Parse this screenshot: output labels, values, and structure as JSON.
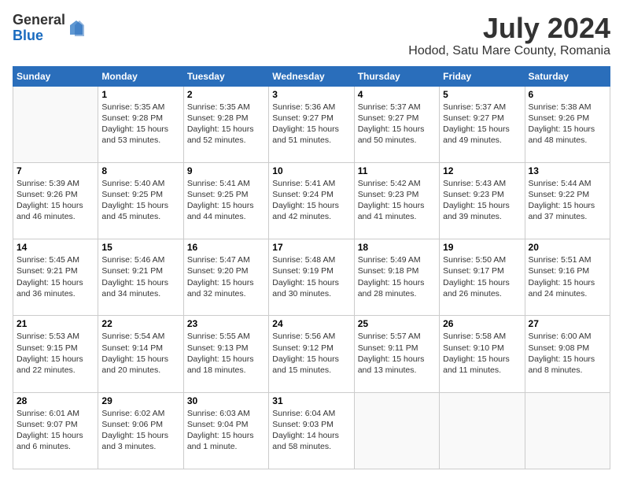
{
  "header": {
    "logo_general": "General",
    "logo_blue": "Blue",
    "month_title": "July 2024",
    "location": "Hodod, Satu Mare County, Romania"
  },
  "weekdays": [
    "Sunday",
    "Monday",
    "Tuesday",
    "Wednesday",
    "Thursday",
    "Friday",
    "Saturday"
  ],
  "weeks": [
    [
      {
        "day": "",
        "content": ""
      },
      {
        "day": "1",
        "content": "Sunrise: 5:35 AM\nSunset: 9:28 PM\nDaylight: 15 hours\nand 53 minutes."
      },
      {
        "day": "2",
        "content": "Sunrise: 5:35 AM\nSunset: 9:28 PM\nDaylight: 15 hours\nand 52 minutes."
      },
      {
        "day": "3",
        "content": "Sunrise: 5:36 AM\nSunset: 9:27 PM\nDaylight: 15 hours\nand 51 minutes."
      },
      {
        "day": "4",
        "content": "Sunrise: 5:37 AM\nSunset: 9:27 PM\nDaylight: 15 hours\nand 50 minutes."
      },
      {
        "day": "5",
        "content": "Sunrise: 5:37 AM\nSunset: 9:27 PM\nDaylight: 15 hours\nand 49 minutes."
      },
      {
        "day": "6",
        "content": "Sunrise: 5:38 AM\nSunset: 9:26 PM\nDaylight: 15 hours\nand 48 minutes."
      }
    ],
    [
      {
        "day": "7",
        "content": "Sunrise: 5:39 AM\nSunset: 9:26 PM\nDaylight: 15 hours\nand 46 minutes."
      },
      {
        "day": "8",
        "content": "Sunrise: 5:40 AM\nSunset: 9:25 PM\nDaylight: 15 hours\nand 45 minutes."
      },
      {
        "day": "9",
        "content": "Sunrise: 5:41 AM\nSunset: 9:25 PM\nDaylight: 15 hours\nand 44 minutes."
      },
      {
        "day": "10",
        "content": "Sunrise: 5:41 AM\nSunset: 9:24 PM\nDaylight: 15 hours\nand 42 minutes."
      },
      {
        "day": "11",
        "content": "Sunrise: 5:42 AM\nSunset: 9:23 PM\nDaylight: 15 hours\nand 41 minutes."
      },
      {
        "day": "12",
        "content": "Sunrise: 5:43 AM\nSunset: 9:23 PM\nDaylight: 15 hours\nand 39 minutes."
      },
      {
        "day": "13",
        "content": "Sunrise: 5:44 AM\nSunset: 9:22 PM\nDaylight: 15 hours\nand 37 minutes."
      }
    ],
    [
      {
        "day": "14",
        "content": "Sunrise: 5:45 AM\nSunset: 9:21 PM\nDaylight: 15 hours\nand 36 minutes."
      },
      {
        "day": "15",
        "content": "Sunrise: 5:46 AM\nSunset: 9:21 PM\nDaylight: 15 hours\nand 34 minutes."
      },
      {
        "day": "16",
        "content": "Sunrise: 5:47 AM\nSunset: 9:20 PM\nDaylight: 15 hours\nand 32 minutes."
      },
      {
        "day": "17",
        "content": "Sunrise: 5:48 AM\nSunset: 9:19 PM\nDaylight: 15 hours\nand 30 minutes."
      },
      {
        "day": "18",
        "content": "Sunrise: 5:49 AM\nSunset: 9:18 PM\nDaylight: 15 hours\nand 28 minutes."
      },
      {
        "day": "19",
        "content": "Sunrise: 5:50 AM\nSunset: 9:17 PM\nDaylight: 15 hours\nand 26 minutes."
      },
      {
        "day": "20",
        "content": "Sunrise: 5:51 AM\nSunset: 9:16 PM\nDaylight: 15 hours\nand 24 minutes."
      }
    ],
    [
      {
        "day": "21",
        "content": "Sunrise: 5:53 AM\nSunset: 9:15 PM\nDaylight: 15 hours\nand 22 minutes."
      },
      {
        "day": "22",
        "content": "Sunrise: 5:54 AM\nSunset: 9:14 PM\nDaylight: 15 hours\nand 20 minutes."
      },
      {
        "day": "23",
        "content": "Sunrise: 5:55 AM\nSunset: 9:13 PM\nDaylight: 15 hours\nand 18 minutes."
      },
      {
        "day": "24",
        "content": "Sunrise: 5:56 AM\nSunset: 9:12 PM\nDaylight: 15 hours\nand 15 minutes."
      },
      {
        "day": "25",
        "content": "Sunrise: 5:57 AM\nSunset: 9:11 PM\nDaylight: 15 hours\nand 13 minutes."
      },
      {
        "day": "26",
        "content": "Sunrise: 5:58 AM\nSunset: 9:10 PM\nDaylight: 15 hours\nand 11 minutes."
      },
      {
        "day": "27",
        "content": "Sunrise: 6:00 AM\nSunset: 9:08 PM\nDaylight: 15 hours\nand 8 minutes."
      }
    ],
    [
      {
        "day": "28",
        "content": "Sunrise: 6:01 AM\nSunset: 9:07 PM\nDaylight: 15 hours\nand 6 minutes."
      },
      {
        "day": "29",
        "content": "Sunrise: 6:02 AM\nSunset: 9:06 PM\nDaylight: 15 hours\nand 3 minutes."
      },
      {
        "day": "30",
        "content": "Sunrise: 6:03 AM\nSunset: 9:04 PM\nDaylight: 15 hours\nand 1 minute."
      },
      {
        "day": "31",
        "content": "Sunrise: 6:04 AM\nSunset: 9:03 PM\nDaylight: 14 hours\nand 58 minutes."
      },
      {
        "day": "",
        "content": ""
      },
      {
        "day": "",
        "content": ""
      },
      {
        "day": "",
        "content": ""
      }
    ]
  ]
}
